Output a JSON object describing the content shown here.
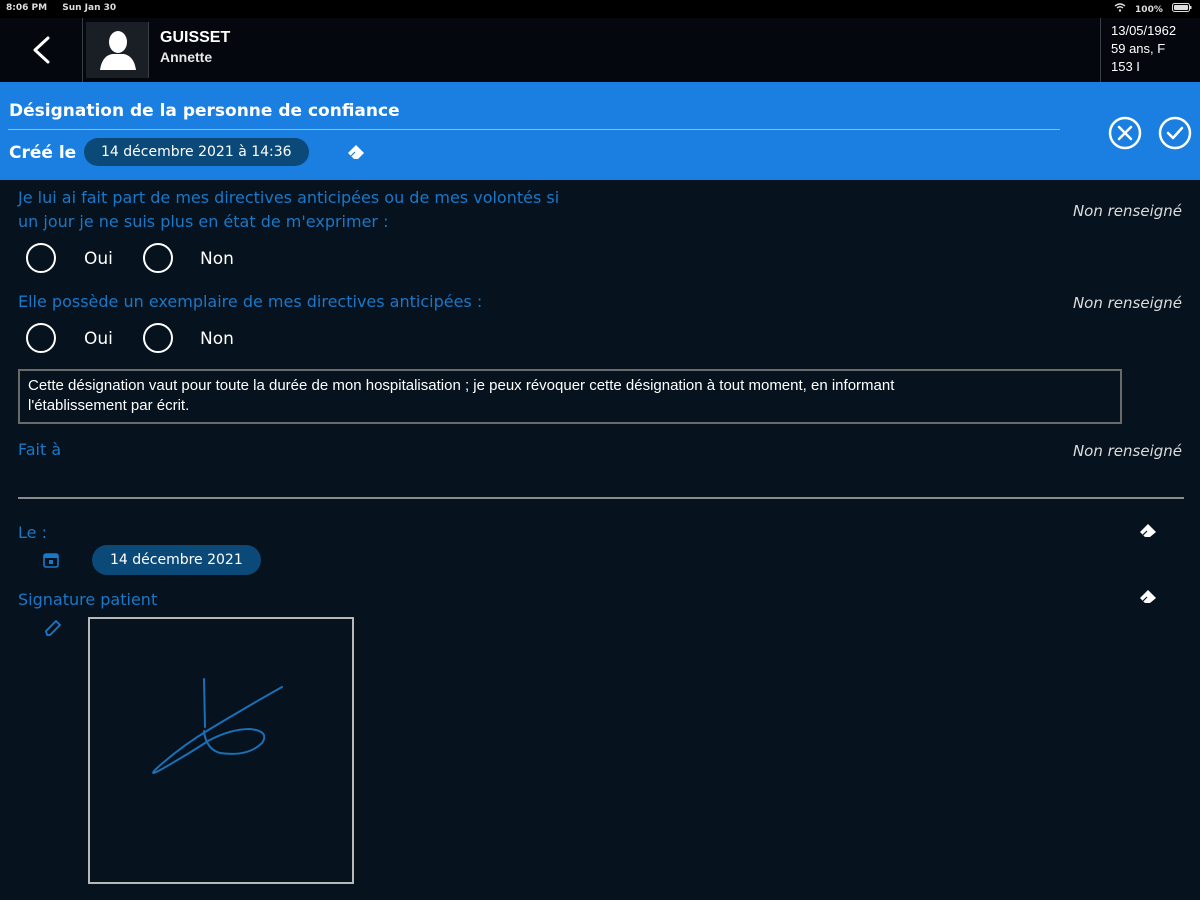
{
  "status_bar": {
    "time": "8:06 PM",
    "date": "Sun Jan 30",
    "battery": "100%"
  },
  "patient": {
    "last_name": "GUISSET",
    "first_name": "Annette",
    "birth_date": "13/05/1962",
    "age_sex": "59 ans, F",
    "room": "153 I"
  },
  "form": {
    "title": "Désignation de la personne de confiance",
    "created_label": "Créé le",
    "created_date": "14 décembre 2021 à 14:36"
  },
  "questions": [
    {
      "line1": "Je lui ai fait part de mes directives anticipées ou de mes volontés si",
      "line2": "un jour je ne suis plus en état de m'exprimer :",
      "status": "Non renseigné",
      "option_yes": "Oui",
      "option_no": "Non"
    },
    {
      "line1": "Elle possède un exemplaire de mes directives anticipées :",
      "status": "Non renseigné",
      "option_yes": "Oui",
      "option_no": "Non"
    }
  ],
  "info_text": {
    "line1": "Cette désignation vaut pour toute la durée de mon hospitalisation ; je peux révoquer cette désignation à tout moment, en informant",
    "line2": "l'établissement par écrit."
  },
  "fait_a": {
    "label": "Fait à",
    "status": "Non renseigné"
  },
  "le": {
    "label": "Le :",
    "date": "14 décembre 2021"
  },
  "signature": {
    "label": "Signature patient"
  },
  "colors": {
    "background": "#06121d",
    "header_blue": "#1a7fe0",
    "label_blue": "#1a78c9",
    "pill_blue": "#0b4a78"
  },
  "icons": {
    "back": "chevron-left-icon",
    "avatar": "user-silhouette-icon",
    "cancel": "circle-x-icon",
    "confirm": "circle-check-icon",
    "eraser": "eraser-icon",
    "calendar": "calendar-icon",
    "pencil": "pencil-icon"
  }
}
